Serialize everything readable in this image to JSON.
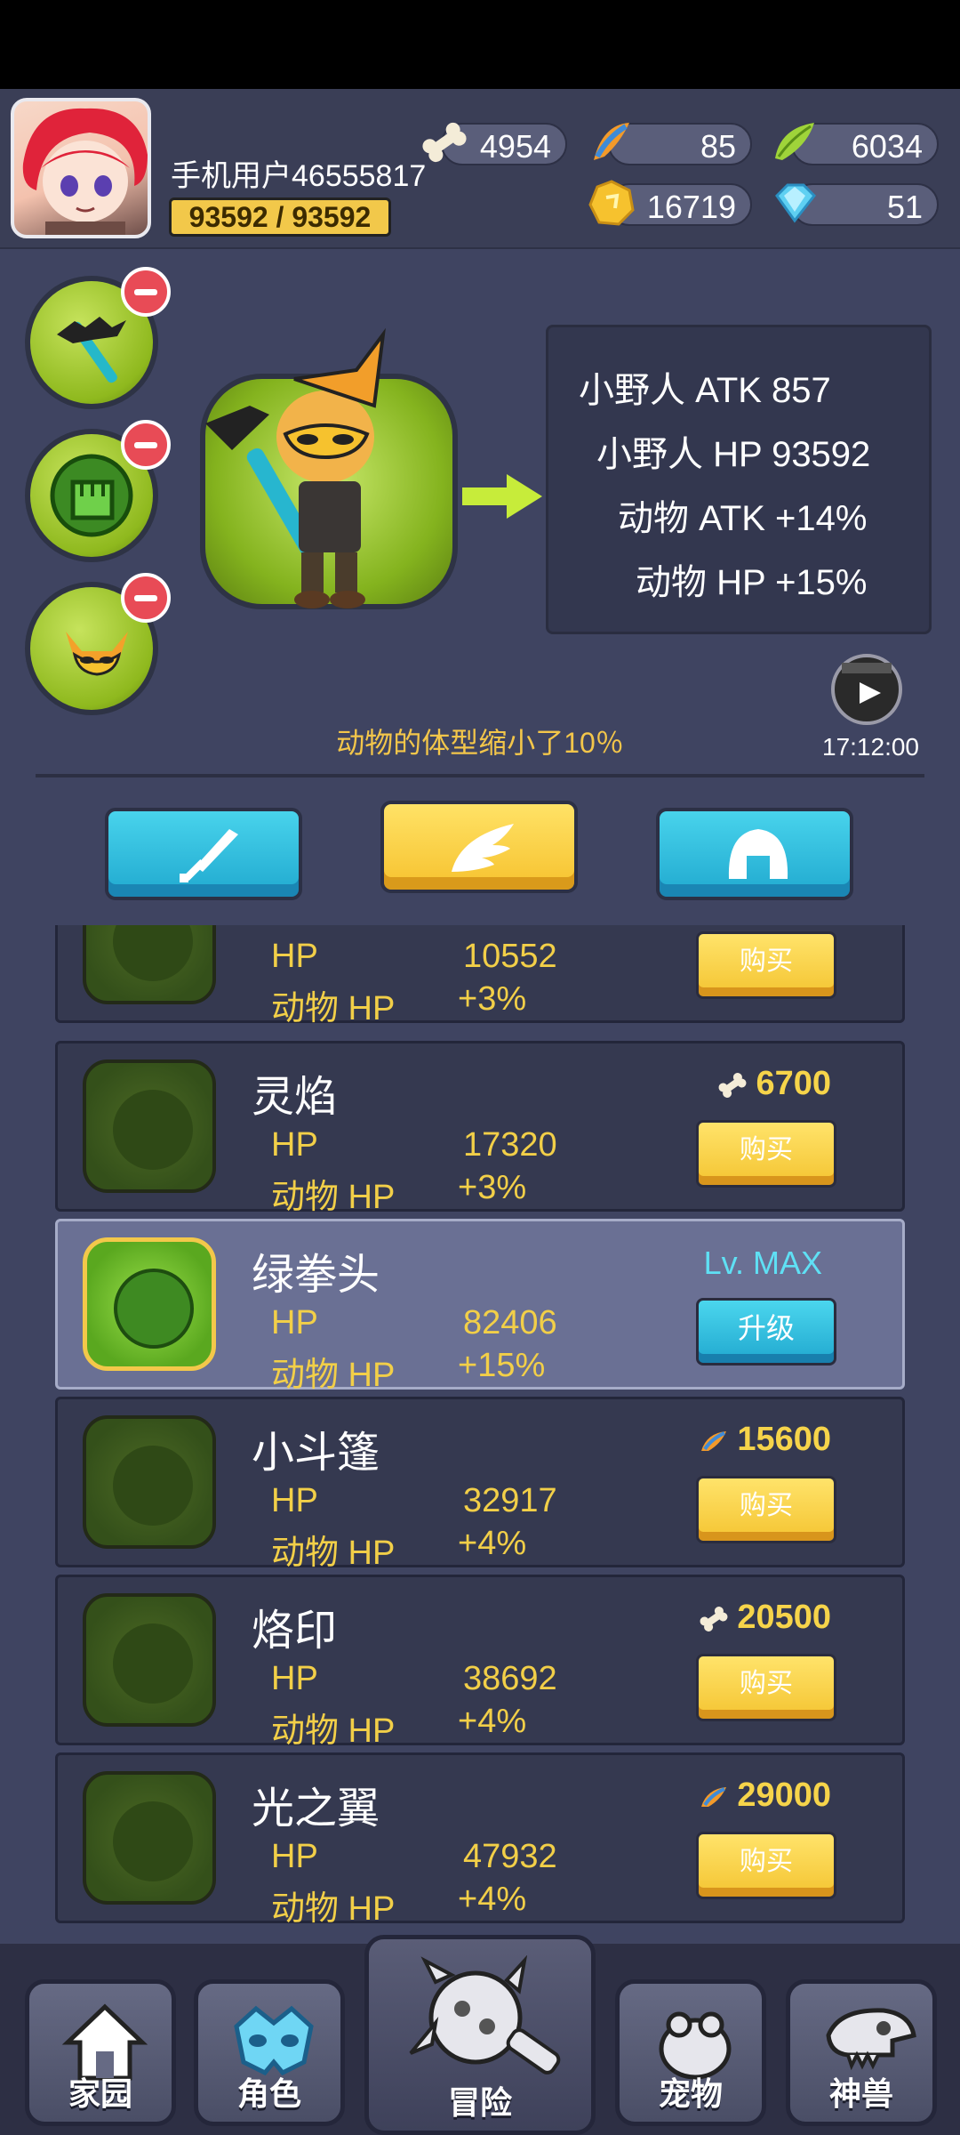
{
  "header": {
    "username": "手机用户46555817",
    "exp": "93592 / 93592",
    "resources": [
      {
        "name": "bone",
        "value": "4954",
        "icon": "bone-icon"
      },
      {
        "name": "feather-orange",
        "value": "85",
        "icon": "orange-feather-icon"
      },
      {
        "name": "feather-green",
        "value": "6034",
        "icon": "green-feather-icon"
      },
      {
        "name": "gold",
        "value": "16719",
        "icon": "gold-coin-icon"
      },
      {
        "name": "diamond",
        "value": "51",
        "icon": "diamond-icon"
      }
    ]
  },
  "stats": {
    "line1": "小野人 ATK 857",
    "line2": "小野人 HP 93592",
    "line3": "动物 ATK +14%",
    "line4": "动物 HP +15%"
  },
  "ad_timer": "17:12:00",
  "notice": "动物的体型缩小了10％",
  "items": [
    {
      "name": "",
      "hp_label": "HP",
      "hp": "10552",
      "animal_label": "动物 HP",
      "animal_hp": "+3%",
      "price": "",
      "action": "购买",
      "state": "locked"
    },
    {
      "name": "灵焰",
      "hp_label": "HP",
      "hp": "17320",
      "animal_label": "动物 HP",
      "animal_hp": "+3%",
      "price": "6700",
      "currency": "bone",
      "action": "购买",
      "state": "locked"
    },
    {
      "name": "绿拳头",
      "hp_label": "HP",
      "hp": "82406",
      "animal_label": "动物 HP",
      "animal_hp": "+15%",
      "level": "Lv. MAX",
      "action": "升级",
      "state": "owned"
    },
    {
      "name": "小斗篷",
      "hp_label": "HP",
      "hp": "32917",
      "animal_label": "动物 HP",
      "animal_hp": "+4%",
      "price": "15600",
      "currency": "orange-feather",
      "action": "购买",
      "state": "locked"
    },
    {
      "name": "烙印",
      "hp_label": "HP",
      "hp": "38692",
      "animal_label": "动物 HP",
      "animal_hp": "+4%",
      "price": "20500",
      "currency": "bone",
      "action": "购买",
      "state": "locked"
    },
    {
      "name": "光之翼",
      "hp_label": "HP",
      "hp": "47932",
      "animal_label": "动物 HP",
      "animal_hp": "+4%",
      "price": "29000",
      "currency": "orange-feather",
      "action": "购买",
      "state": "locked"
    }
  ],
  "nav": [
    {
      "label": "家园",
      "icon": "home-icon"
    },
    {
      "label": "角色",
      "icon": "mask-icon"
    },
    {
      "label": "冒险",
      "icon": "spiked-club-icon"
    },
    {
      "label": "宠物",
      "icon": "frog-icon"
    },
    {
      "label": "神兽",
      "icon": "dinosaur-skull-icon"
    }
  ],
  "colors": {
    "accent": "#f3c64a",
    "panel": "#353950",
    "blue_button": "#20a9cf"
  }
}
